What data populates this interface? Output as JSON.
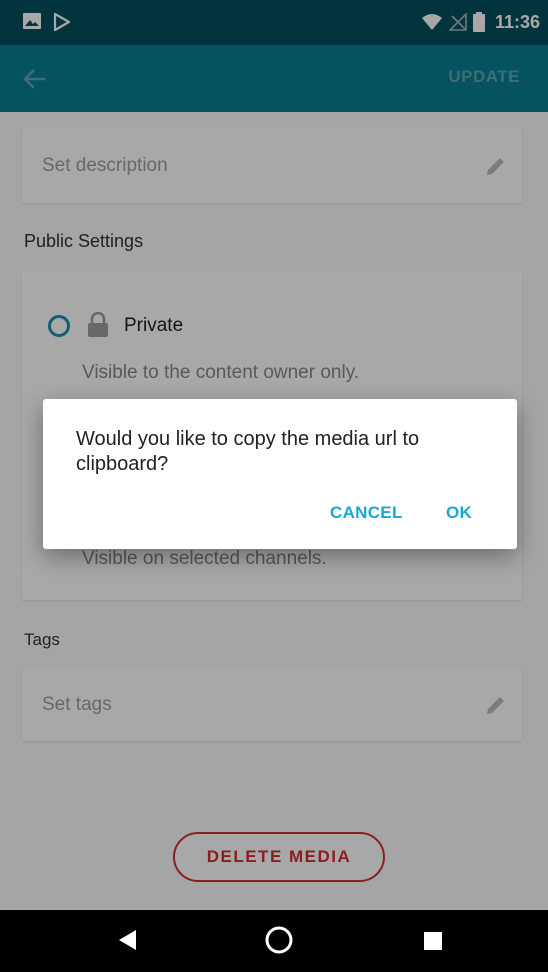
{
  "status_bar": {
    "time": "11:36",
    "icons": [
      "image-icon",
      "play-store-icon",
      "wifi-icon",
      "no-signal-icon",
      "battery-icon"
    ]
  },
  "app_bar": {
    "back_icon": "arrow-left-icon",
    "update_label": "UPDATE"
  },
  "form": {
    "description_placeholder": "Set description",
    "public_settings_label": "Public Settings",
    "privacy_option": {
      "label": "Private",
      "description": "Visible to the content owner only."
    },
    "channels_option_description": "Visible on selected channels.",
    "tags_label": "Tags",
    "tags_placeholder": "Set tags",
    "delete_label": "DELETE MEDIA"
  },
  "dialog": {
    "message": "Would you like to copy the media url to clipboard?",
    "cancel_label": "CANCEL",
    "ok_label": "OK"
  },
  "colors": {
    "status_bar": "#04505f",
    "app_bar": "#087f93",
    "dialog_accent": "#1ba6d3",
    "delete_accent": "#d32f2f"
  }
}
